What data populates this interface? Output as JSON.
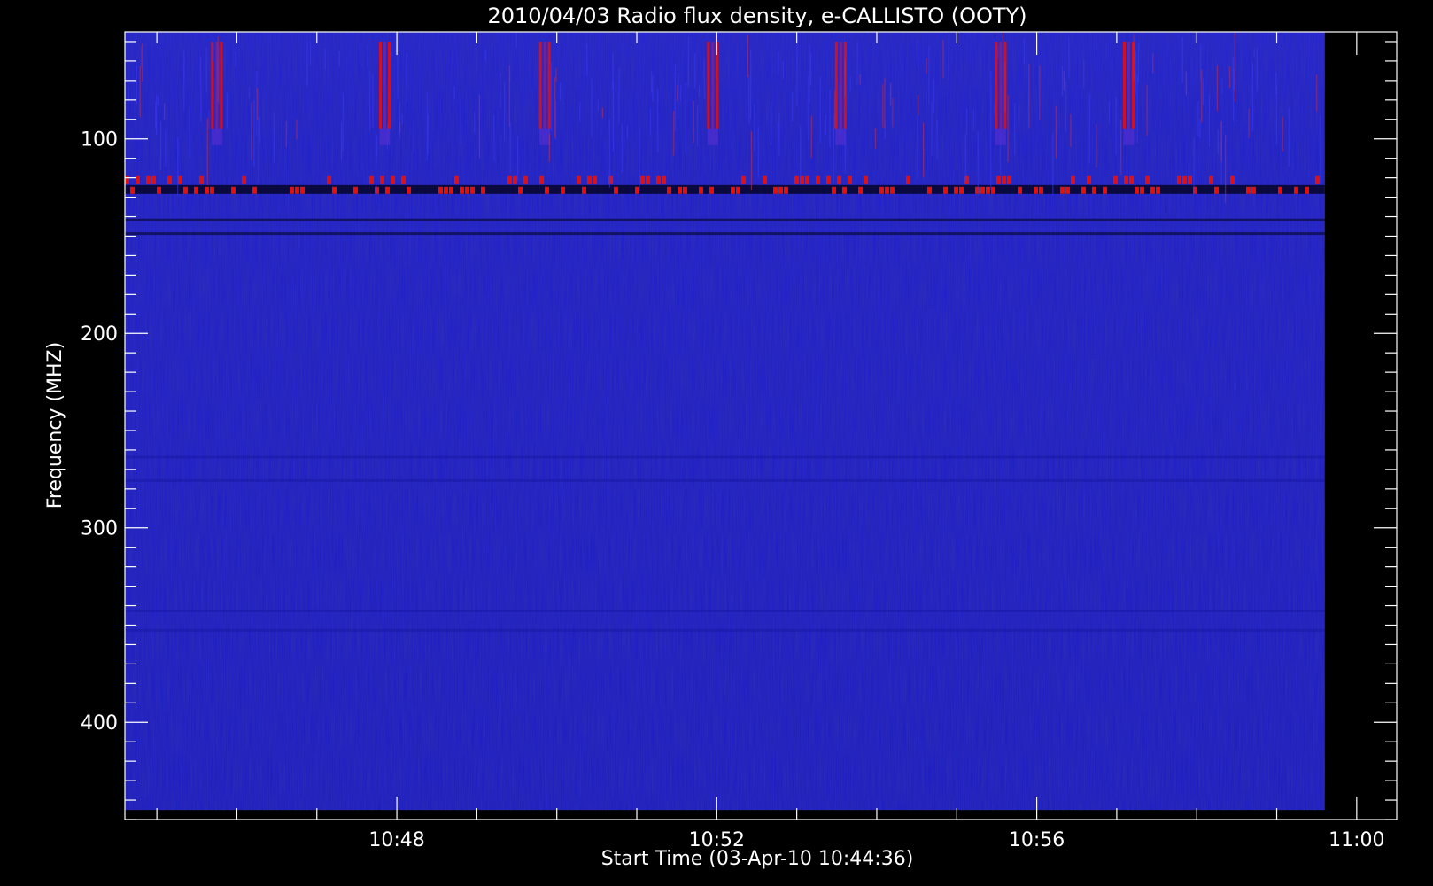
{
  "chart_data": {
    "type": "heatmap",
    "title": "2010/04/03  Radio flux density, e-CALLISTO (OOTY)",
    "xlabel": "Start Time (03-Apr-10 10:44:36)",
    "ylabel": "Frequency (MHZ)",
    "x_range": [
      "10:44:36",
      "11:00:00"
    ],
    "xlim_minutes": [
      44.6,
      60.5
    ],
    "ylim": [
      45,
      450
    ],
    "y_inverted": true,
    "data_x_range_minutes": [
      44.6,
      59.6
    ],
    "data_y_range": [
      45,
      445
    ],
    "x_major_ticks": [
      {
        "value": 48,
        "label": "10:48"
      },
      {
        "value": 52,
        "label": "10:52"
      },
      {
        "value": 56,
        "label": "10:56"
      },
      {
        "value": 60,
        "label": "11:00"
      }
    ],
    "x_minor_step": 1,
    "y_major_ticks": [
      {
        "value": 100,
        "label": "100"
      },
      {
        "value": 200,
        "label": "200"
      },
      {
        "value": 300,
        "label": "300"
      },
      {
        "value": 400,
        "label": "400"
      }
    ],
    "y_minor_step": 10,
    "grid": false,
    "colors": {
      "background": "#000000",
      "spectrum_base": "#1c1cd2",
      "burst": "#e01010",
      "dark_band": "#050528"
    },
    "features": {
      "periodic_bursts": {
        "times_min": [
          45.75,
          47.85,
          49.85,
          51.95,
          53.55,
          55.55,
          57.15
        ],
        "freq_range": [
          50,
          95
        ]
      },
      "interference_band": {
        "freq_range": [
          121,
          135
        ]
      },
      "dark_lines": [
        141,
        148
      ]
    }
  }
}
